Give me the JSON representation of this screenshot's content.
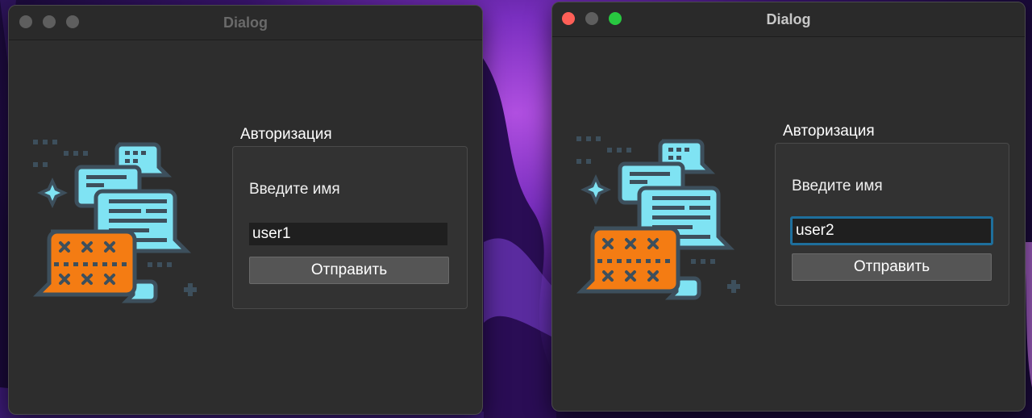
{
  "colors": {
    "window_bg": "#2d2d2d",
    "title_active": "#c8c8c8",
    "title_inactive": "#6a6a6a",
    "close": "#ff5f57",
    "minimize": "#5e5e5e",
    "zoom": "#28c840",
    "illustration_cyan": "#7fe3f3",
    "illustration_orange": "#f47c13",
    "focus_ring": "#1e6f9c"
  },
  "windows": [
    {
      "title": "Dialog",
      "active": false,
      "illustration": "chat-bubbles-password-icon",
      "group": {
        "title": "Авторизация",
        "prompt": "Введите имя",
        "input_value": "user1",
        "submit_label": "Отправить"
      }
    },
    {
      "title": "Dialog",
      "active": true,
      "illustration": "chat-bubbles-password-icon",
      "group": {
        "title": "Авторизация",
        "prompt": "Введите имя",
        "input_value": "user2",
        "submit_label": "Отправить"
      }
    }
  ]
}
